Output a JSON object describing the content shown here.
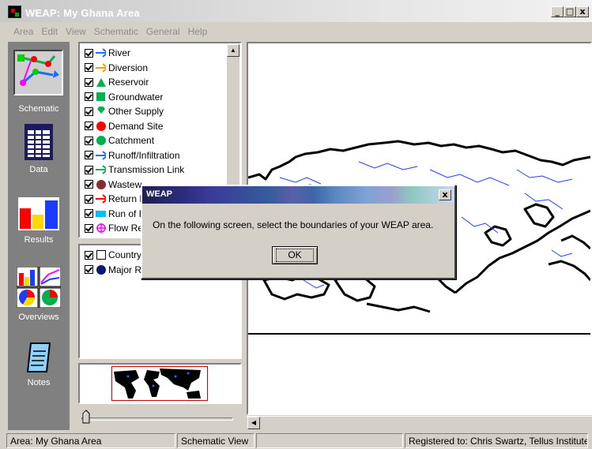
{
  "window": {
    "title": "WEAP: My Ghana Area",
    "controls": [
      "_",
      "□",
      "x"
    ]
  },
  "menu": [
    "Area",
    "Edit",
    "View",
    "Schematic",
    "General",
    "Help"
  ],
  "sidebar": {
    "items": [
      {
        "label": "Schematic",
        "icon": "schematic-icon",
        "active": true
      },
      {
        "label": "Data",
        "icon": "data-icon"
      },
      {
        "label": "Results",
        "icon": "results-icon"
      },
      {
        "label": "Overviews",
        "icon": "overviews-icon"
      },
      {
        "label": "Notes",
        "icon": "notes-icon"
      }
    ]
  },
  "legend_top": [
    {
      "label": "River",
      "checked": true,
      "symbol": "blue-arrow"
    },
    {
      "label": "Diversion",
      "checked": true,
      "symbol": "orange-arrow"
    },
    {
      "label": "Reservoir",
      "checked": true,
      "symbol": "green-triangle"
    },
    {
      "label": "Groundwater",
      "checked": true,
      "symbol": "green-square"
    },
    {
      "label": "Other Supply",
      "checked": true,
      "symbol": "green-diamond"
    },
    {
      "label": "Demand Site",
      "checked": true,
      "symbol": "red-circle"
    },
    {
      "label": "Catchment",
      "checked": true,
      "symbol": "green-circle"
    },
    {
      "label": "Runoff/Infiltration",
      "checked": true,
      "symbol": "blue-arrow"
    },
    {
      "label": "Transmission Link",
      "checked": true,
      "symbol": "green-arrow"
    },
    {
      "label": "Wastew",
      "checked": true,
      "symbol": "brown-circle"
    },
    {
      "label": "Return F",
      "checked": true,
      "symbol": "red-arrow"
    },
    {
      "label": "Run of F",
      "checked": true,
      "symbol": "cyan-bar"
    },
    {
      "label": "Flow Re",
      "checked": true,
      "symbol": "magenta-target"
    }
  ],
  "legend_bottom": [
    {
      "label": "Country",
      "checked": true,
      "symbol": "empty-square"
    },
    {
      "label": "Major Ri",
      "checked": true,
      "symbol": "navy-circle"
    }
  ],
  "dialog": {
    "title": "WEAP",
    "message": "On the following screen, select the boundaries of your WEAP area.",
    "ok_label": "OK",
    "close": "x"
  },
  "status": {
    "area": "Area: My Ghana Area",
    "view": "Schematic View",
    "empty": "",
    "registered": "Registered to: Chris Swartz, Tellus Institute ..."
  },
  "colors": {
    "river": "#1e6bff",
    "diversion": "#f0a000",
    "green": "#00b050",
    "red": "#ff0000",
    "sidebar": "#808080"
  }
}
